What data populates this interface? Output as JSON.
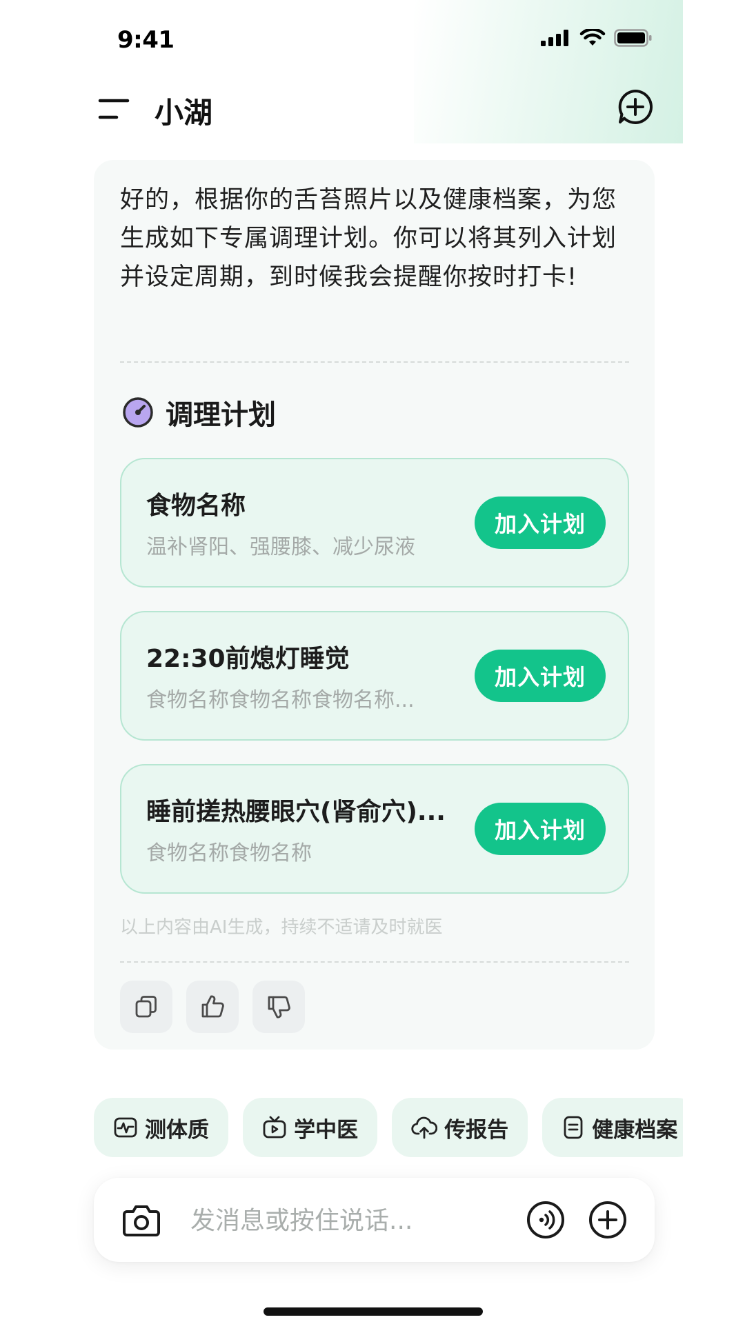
{
  "status_bar": {
    "time": "9:41",
    "icons": [
      "signal-icon",
      "wifi-icon",
      "battery-icon"
    ]
  },
  "header": {
    "title": "小湖",
    "left_icon": "menu-icon",
    "right_icon": "new-chat-icon"
  },
  "chat": {
    "message": "好的，根据你的舌苔照片以及健康档案，为您生成如下专属调理计划。你可以将其列入计划并设定周期，到时候我会提醒你按时打卡!",
    "section_title": "调理计划",
    "section_icon": "plan-gauge-icon",
    "plans": [
      {
        "name": "食物名称",
        "desc": "温补肾阳、强腰膝、减少尿液",
        "button": "加入计划"
      },
      {
        "name": "22:30前熄灯睡觉",
        "desc": "食物名称食物名称食物名称...",
        "button": "加入计划"
      },
      {
        "name": "睡前搓热腰眼穴(肾俞穴)...",
        "desc": "食物名称食物名称",
        "button": "加入计划"
      }
    ],
    "disclaimer": "以上内容由AI生成，持续不适请及时就医",
    "feedback_icons": [
      "copy-icon",
      "thumbs-up-icon",
      "thumbs-down-icon"
    ]
  },
  "quick_actions": [
    {
      "label": "测体质",
      "icon": "pulse-icon"
    },
    {
      "label": "学中医",
      "icon": "tv-icon"
    },
    {
      "label": "传报告",
      "icon": "cloud-upload-icon"
    },
    {
      "label": "健康档案",
      "icon": "document-icon"
    }
  ],
  "input_bar": {
    "placeholder": "发消息或按住说话...",
    "left_icon": "camera-icon",
    "right_icons": [
      "voice-icon",
      "add-icon"
    ]
  },
  "colors": {
    "accent": "#13c48b",
    "card_bg": "#e9f7f1",
    "card_border": "#b6e6d2",
    "chat_bg": "#f6f9f8",
    "chip_bg": "#e9f6f0",
    "muted_text": "#a4a9a7",
    "icon_purple": "#b9a6f0"
  }
}
